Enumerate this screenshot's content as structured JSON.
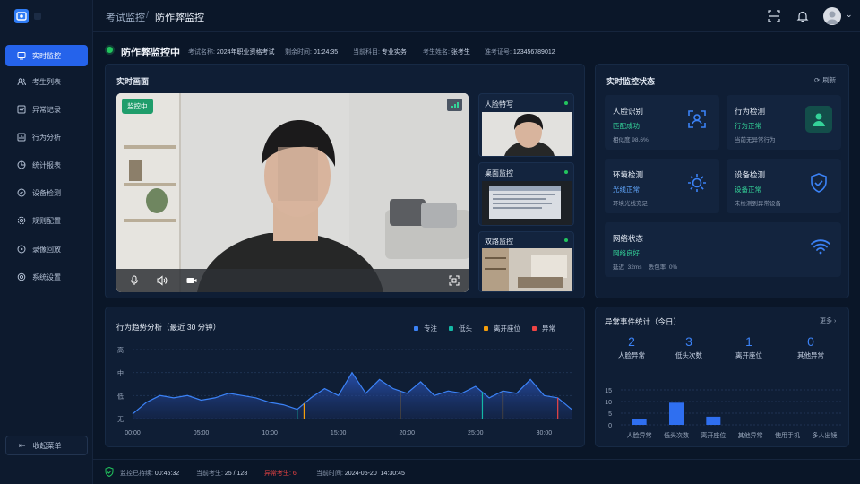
{
  "sidebar": {
    "items": [
      {
        "label": "实时监控",
        "icon": "monitor-icon",
        "active": true
      },
      {
        "label": "考生列表",
        "icon": "users-icon"
      },
      {
        "label": "异常记录",
        "icon": "record-icon"
      },
      {
        "label": "行为分析",
        "icon": "analysis-icon"
      },
      {
        "label": "统计报表",
        "icon": "report-icon"
      },
      {
        "label": "设备检测",
        "icon": "device-icon"
      },
      {
        "label": "规则配置",
        "icon": "settings-icon"
      },
      {
        "label": "录像回放",
        "icon": "play-icon"
      },
      {
        "label": "系统设置",
        "icon": "gear-icon"
      }
    ],
    "collapse_label": "收起菜单"
  },
  "header": {
    "breadcrumb_parent": "考试监控",
    "breadcrumb_sep": "/",
    "breadcrumb_current": "防作弊监控"
  },
  "status_bar": {
    "title": "防作弊监控中",
    "exam_name_label": "考试名称:",
    "exam_name": "2024年职业资格考试",
    "remaining_label": "剩余时间:",
    "remaining": "01:24:35",
    "subject_label": "当前科目:",
    "subject": "专业实务",
    "examinee_label": "考生姓名:",
    "examinee": "张考生",
    "ticket_label": "准考证号:",
    "ticket": "123456789012"
  },
  "video": {
    "title": "实时画面",
    "badge": "监控中",
    "thumbs": [
      {
        "title": "人脸特写"
      },
      {
        "title": "桌面监控"
      },
      {
        "title": "双路监控"
      }
    ]
  },
  "status_panel": {
    "title": "实时监控状态",
    "refresh": "刷新",
    "cards": [
      {
        "title": "人脸识别",
        "status": "匹配成功",
        "detail": "相似度  98.6%",
        "icon": "face-scan-icon"
      },
      {
        "title": "行为检测",
        "status": "行为正常",
        "detail": "当前无异常行为",
        "icon": "person-icon"
      },
      {
        "title": "环境检测",
        "status": "光线正常",
        "detail": "环境光线充足",
        "icon": "sun-icon"
      },
      {
        "title": "设备检测",
        "status": "设备正常",
        "detail": "未检测到异常设备",
        "icon": "shield-check-icon"
      },
      {
        "title": "网络状态",
        "status": "网络良好",
        "detail": "延迟  32ms    丢包率  0%",
        "icon": "wifi-icon"
      }
    ]
  },
  "trend": {
    "title": "行为趋势分析（最近 30 分钟）",
    "legend": [
      {
        "name": "专注",
        "color": "#3b82f6"
      },
      {
        "name": "低头",
        "color": "#14b8a6"
      },
      {
        "name": "离开座位",
        "color": "#f59e0b"
      },
      {
        "name": "异常",
        "color": "#ef4444"
      }
    ],
    "y_labels": [
      "高",
      "中",
      "低",
      "无"
    ],
    "x_labels": [
      "00:00",
      "05:00",
      "10:00",
      "15:00",
      "20:00",
      "25:00",
      "30:00"
    ]
  },
  "anomaly": {
    "title": "异常事件统计（今日）",
    "more": "更多",
    "counts": [
      {
        "value": "2",
        "label": "人脸异常"
      },
      {
        "value": "3",
        "label": "低头次数"
      },
      {
        "value": "1",
        "label": "离开座位"
      },
      {
        "value": "0",
        "label": "其他异常"
      }
    ]
  },
  "chart_data": [
    {
      "type": "area",
      "title": "行为趋势分析（最近 30 分钟）",
      "y_categories": [
        "无",
        "低",
        "中",
        "高"
      ],
      "ylim": [
        0,
        3
      ],
      "x_ticks": [
        "00:00",
        "05:00",
        "10:00",
        "15:00",
        "20:00",
        "25:00",
        "30:00"
      ],
      "series": [
        {
          "name": "专注",
          "x": [
            0,
            1,
            2,
            3,
            4,
            5,
            6,
            7,
            8,
            9,
            10,
            11,
            12,
            13,
            14,
            15,
            16,
            17,
            18,
            19,
            20,
            21,
            22,
            23,
            24,
            25,
            26,
            27,
            28,
            29,
            30,
            31,
            32
          ],
          "values": [
            0.2,
            0.7,
            1.0,
            0.9,
            1.0,
            0.8,
            0.9,
            1.1,
            1.0,
            0.9,
            0.7,
            0.6,
            0.4,
            0.9,
            1.3,
            1.0,
            2.0,
            1.1,
            1.7,
            1.3,
            1.1,
            1.6,
            1.0,
            1.2,
            1.1,
            1.4,
            0.9,
            1.2,
            1.1,
            1.7,
            1.0,
            0.9,
            0.4
          ]
        }
      ],
      "events": [
        {
          "series": "低头",
          "x": [
            12,
            25.5
          ]
        },
        {
          "series": "离开座位",
          "x": [
            12.5,
            19.5,
            27
          ]
        },
        {
          "series": "异常",
          "x": [
            31
          ]
        }
      ],
      "grid": true,
      "legend": "top-right"
    },
    {
      "type": "bar",
      "categories": [
        "人脸异常",
        "低头次数",
        "离开座位",
        "其他异常",
        "使用手机",
        "多人出镜"
      ],
      "values": [
        2.5,
        9.5,
        3.5,
        0,
        0,
        0
      ],
      "ylim": [
        0,
        15
      ],
      "y_ticks": [
        0,
        5,
        10,
        15
      ],
      "grid": true
    }
  ],
  "footer": {
    "duration_label": "监控已持续:",
    "duration": "00:45:32",
    "current_label": "当前考生:",
    "current": "25 / 128",
    "abnormal_label": "异常考生:",
    "abnormal": "6",
    "time_label": "当前时间:",
    "time": "2024-05-20  14:30:45"
  }
}
